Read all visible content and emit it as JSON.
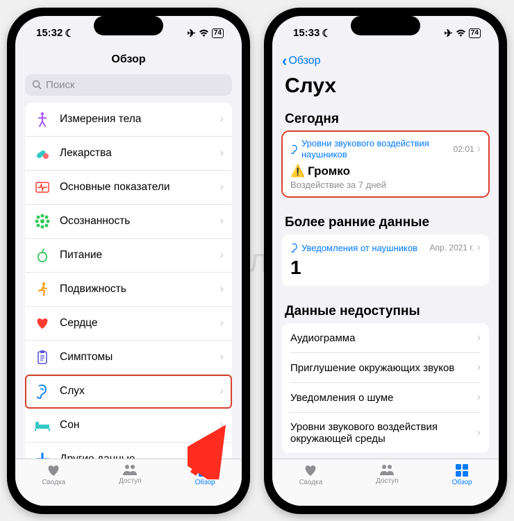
{
  "watermark": "Яблык",
  "phone1": {
    "status": {
      "time": "15:32",
      "battery": "74"
    },
    "title": "Обзор",
    "search_placeholder": "Поиск",
    "categories": [
      {
        "icon": "body",
        "color": "#a259ff",
        "label": "Измерения тела"
      },
      {
        "icon": "pills",
        "color": "#34c8c8",
        "label": "Лекарства"
      },
      {
        "icon": "vitals",
        "color": "#ff3b30",
        "label": "Основные показатели"
      },
      {
        "icon": "mind",
        "color": "#34c759",
        "label": "Осознанность"
      },
      {
        "icon": "nutrition",
        "color": "#34c759",
        "label": "Питание"
      },
      {
        "icon": "mobility",
        "color": "#ff9500",
        "label": "Подвижность"
      },
      {
        "icon": "heart",
        "color": "#ff3b30",
        "label": "Сердце"
      },
      {
        "icon": "symptoms",
        "color": "#5856d6",
        "label": "Симптомы"
      },
      {
        "icon": "hearing",
        "color": "#007aff",
        "label": "Слух",
        "highlight": true
      },
      {
        "icon": "sleep",
        "color": "#34c8c8",
        "label": "Сон"
      },
      {
        "icon": "other",
        "color": "#007aff",
        "label": "Другие данные"
      }
    ],
    "tabs": [
      {
        "label": "Сводка",
        "icon": "heart"
      },
      {
        "label": "Доступ",
        "icon": "people"
      },
      {
        "label": "Обзор",
        "icon": "grid",
        "active": true
      }
    ]
  },
  "phone2": {
    "status": {
      "time": "15:33",
      "battery": "74"
    },
    "back_label": "Обзор",
    "title": "Слух",
    "sections": {
      "today": {
        "header": "Сегодня",
        "card": {
          "title": "Уровни звукового воздействия наушников",
          "timestamp": "02:01",
          "value": "Громко",
          "subtitle": "Воздействие за 7 дней"
        }
      },
      "earlier": {
        "header": "Более ранние данные",
        "card": {
          "title": "Уведомления от наушников",
          "timestamp": "Апр. 2021 г.",
          "value": "1"
        }
      },
      "unavailable": {
        "header": "Данные недоступны",
        "items": [
          "Аудиограмма",
          "Приглушение окружающих звуков",
          "Уведомления о шуме",
          "Уровни звукового воздействия окружающей среды"
        ]
      }
    },
    "tabs": [
      {
        "label": "Сводка",
        "icon": "heart"
      },
      {
        "label": "Доступ",
        "icon": "people"
      },
      {
        "label": "Обзор",
        "icon": "grid",
        "active": true
      }
    ]
  }
}
